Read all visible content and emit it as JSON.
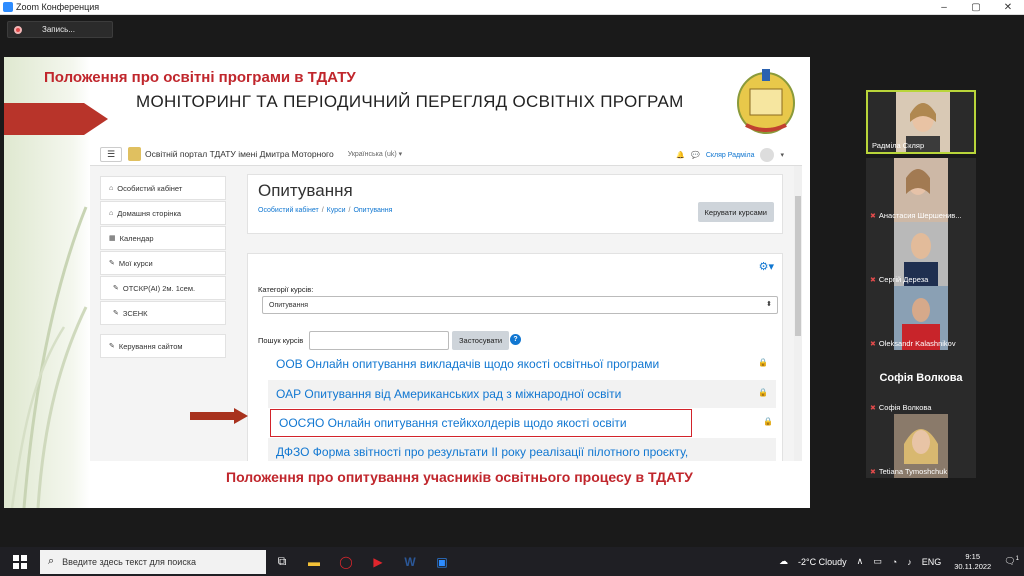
{
  "window": {
    "title": "Zoom Конференция",
    "controls": [
      "–",
      "▢",
      "✕"
    ]
  },
  "recording": {
    "label": "Запись..."
  },
  "slide": {
    "title1": "Положення про освітні програми в ТДАТУ",
    "title2": "МОНІТОРИНГ ТА ПЕРІОДИЧНИЙ ПЕРЕГЛЯД ОСВІТНІХ ПРОГРАМ",
    "footer": "Положення про опитування учасників освітнього процесу в ТДАТУ"
  },
  "moodle": {
    "site_name": "Освітній портал ТДАТУ імені Дмитра Моторного",
    "language": "Українська (uk) ▾",
    "user_name": "Скляр Радміла",
    "sidebar_top": [
      {
        "icon": "⌂",
        "label": "Особистий кабінет"
      },
      {
        "icon": "⌂",
        "label": "Домашня сторінка"
      },
      {
        "icon": "▦",
        "label": "Календар"
      },
      {
        "icon": "✎",
        "label": "Мої курси"
      },
      {
        "icon": "✎",
        "label": "ОТСКР(АІ) 2м. 1сем."
      },
      {
        "icon": "✎",
        "label": "ЗСЕНК"
      }
    ],
    "sidebar_bottom": [
      {
        "icon": "✎",
        "label": "Керування сайтом"
      }
    ],
    "page_title": "Опитування",
    "breadcrumb": [
      "Особистий кабінет",
      "Курси",
      "Опитування"
    ],
    "manage_button": "Керувати курсами",
    "category_label": "Категорії курсів:",
    "category_value": "Опитування",
    "search_label": "Пошук курсів",
    "search_placeholder": "",
    "search_button": "Застосувати",
    "courses": [
      {
        "label": "ООВ Онлайн опитування викладачів щодо якості освітньої програми"
      },
      {
        "label": "ОАР Опитування від Американських рад з міжнародної освіти"
      },
      {
        "label": "ООСЯО Онлайн опитування стейкхолдерів щодо якості освіти"
      },
      {
        "label": "ДФЗО Форма звітності про результати II року реалізації пілотного проєкту,"
      }
    ]
  },
  "participants": [
    {
      "name": "Радміла Скляр",
      "muted": false
    },
    {
      "name": "Анастасия Шершенив...",
      "muted": true
    },
    {
      "name": "Сергій Дереза",
      "muted": true
    },
    {
      "name": "Oleksandr Kalashnikov",
      "muted": true
    },
    {
      "name": "Софія Волкова",
      "muted": true,
      "display": "Софія Волкова"
    },
    {
      "name": "Tetiana Tymoshchuk",
      "muted": true
    }
  ],
  "taskbar": {
    "search_placeholder": "Введите здесь текст для поиска",
    "weather": "-2°C  Cloudy",
    "lang": "ENG",
    "time": "9:15",
    "date": "30.11.2022",
    "notifications": "1"
  }
}
